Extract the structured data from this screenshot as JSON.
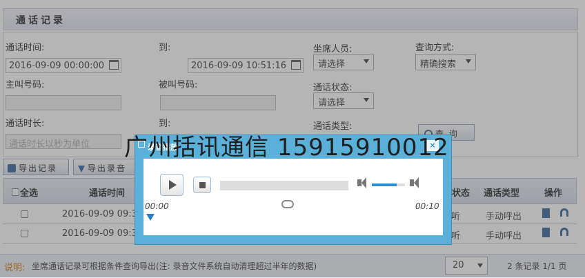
{
  "page": {
    "title": "通话记录"
  },
  "form": {
    "call_time_label": "通话时间:",
    "call_time_start": "2016-09-09 00:00:00",
    "to_label_1": "到:",
    "call_time_end": "2016-09-09 10:51:16",
    "agent_label": "坐席人员:",
    "agent_value": "请选择",
    "query_mode_label": "查询方式:",
    "query_mode_value": "精确搜索",
    "caller_label": "主叫号码:",
    "callee_label": "被叫号码:",
    "call_status_label": "通话状态:",
    "call_status_value": "请选择",
    "duration_label": "通话时长:",
    "duration_placeholder": "通话时长以秒为单位",
    "to_label_2": "到:",
    "call_type_label": "通话类型:",
    "search_label": "查 询"
  },
  "toolbar": {
    "export_records": "导出记录",
    "export_recordings": "导出录音"
  },
  "grid": {
    "select_all": "全选",
    "col_call_time": "通话时间",
    "col_status_partial": "状态",
    "col_call_type": "通话类型",
    "col_actions": "操作",
    "rows": [
      {
        "time": "2016-09-09 09:3",
        "status": "听",
        "type": "手动呼出"
      },
      {
        "time": "2016-09-09 09:3",
        "status": "听",
        "type": "手动呼出"
      }
    ]
  },
  "footer": {
    "note_prefix": "说明:",
    "note_text": "坐席通话记录可根据条件查询导出(注: 录音文件系统自动清理超过半年的数据)",
    "page_size": "20",
    "summary": "2 条记录 1/1 页"
  },
  "dialog": {
    "title": "录音播放",
    "close": "×",
    "time_current": "00:00",
    "time_total": "00:10",
    "volume": 0.75,
    "progress": 0
  },
  "watermark": "广州括讯通信 15915910012",
  "colors": {
    "dialog_bg": "#5ab0d8",
    "header_bg": "#e1e3f1",
    "accent": "#3d8fbb"
  }
}
